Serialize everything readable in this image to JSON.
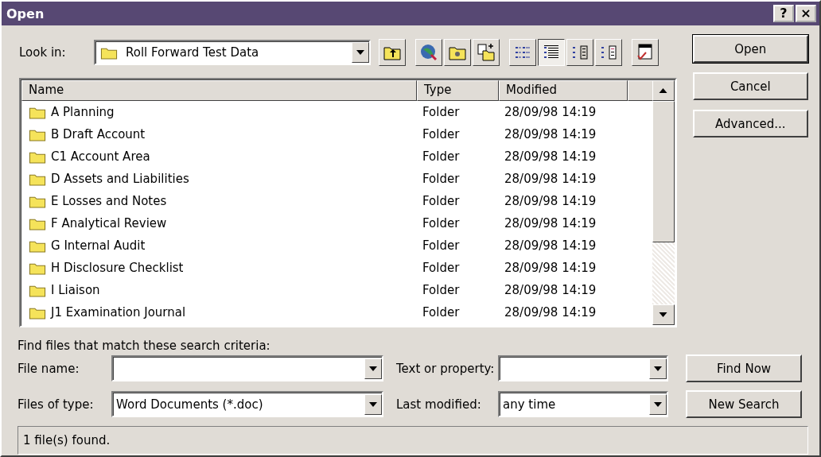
{
  "window": {
    "title": "Open",
    "help": "?",
    "close": "×"
  },
  "look_in": {
    "label": "Look in:",
    "value": "Roll Forward Test Data"
  },
  "toolbar": [
    {
      "kind": "up",
      "selected": false
    },
    {
      "kind": "web",
      "selected": false
    },
    {
      "kind": "favorites",
      "selected": false
    },
    {
      "kind": "addfav",
      "selected": false
    },
    {
      "kind": "list",
      "selected": false
    },
    {
      "kind": "details",
      "selected": true
    },
    {
      "kind": "properties",
      "selected": false
    },
    {
      "kind": "preview",
      "selected": false
    },
    {
      "kind": "commands",
      "selected": false
    }
  ],
  "table": {
    "columns": [
      "Name",
      "Type",
      "Modified"
    ],
    "rows": [
      {
        "name": "A Planning",
        "type": "Folder",
        "modified": "28/09/98 14:19"
      },
      {
        "name": "B Draft Account",
        "type": "Folder",
        "modified": "28/09/98 14:19"
      },
      {
        "name": "C1 Account Area",
        "type": "Folder",
        "modified": "28/09/98 14:19"
      },
      {
        "name": "D Assets and Liabilities",
        "type": "Folder",
        "modified": "28/09/98 14:19"
      },
      {
        "name": "E Losses and Notes",
        "type": "Folder",
        "modified": "28/09/98 14:19"
      },
      {
        "name": "F Analytical Review",
        "type": "Folder",
        "modified": "28/09/98 14:19"
      },
      {
        "name": "G Internal Audit",
        "type": "Folder",
        "modified": "28/09/98 14:19"
      },
      {
        "name": "H Disclosure Checklist",
        "type": "Folder",
        "modified": "28/09/98 14:19"
      },
      {
        "name": "I Liaison",
        "type": "Folder",
        "modified": "28/09/98 14:19"
      },
      {
        "name": "J1 Examination Journal",
        "type": "Folder",
        "modified": "28/09/98 14:19"
      }
    ]
  },
  "buttons": [
    {
      "label": "Open",
      "default": true
    },
    {
      "label": "Cancel",
      "default": false
    },
    {
      "label": "Advanced...",
      "default": false
    }
  ],
  "search": {
    "heading": "Find files that match these search criteria:",
    "fields": [
      {
        "label": "File name:"
      },
      {
        "label": "Text or property:"
      },
      {
        "label": "Files of type:",
        "value": "Word Documents (*.doc)"
      },
      {
        "label": "Last modified:",
        "value": "any time"
      }
    ],
    "buttons": [
      "Find Now",
      "New Search"
    ]
  },
  "status_bar": "1 file(s) found."
}
